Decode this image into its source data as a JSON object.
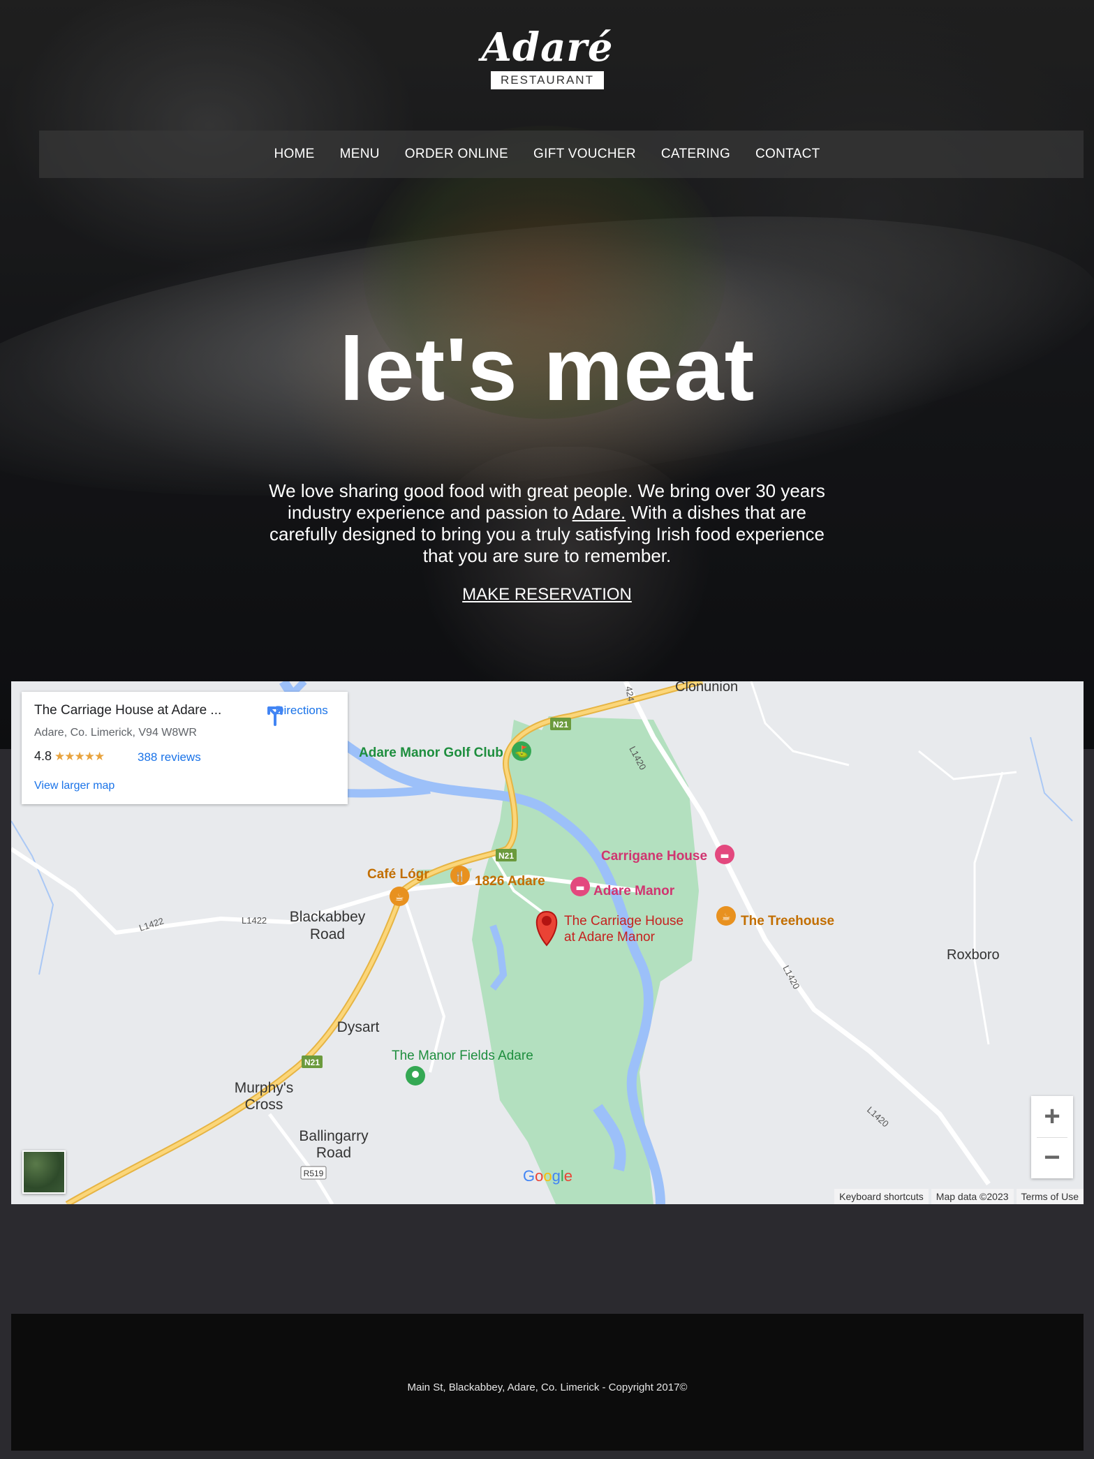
{
  "header": {
    "logo_script": "Adaré",
    "logo_sub": "RESTAURANT"
  },
  "nav": {
    "items": [
      "HOME",
      "MENU",
      "ORDER ONLINE",
      "GIFT VOUCHER",
      "CATERING",
      "CONTACT"
    ]
  },
  "hero": {
    "headline": "let's meat",
    "intro_before": "We love sharing good food with great people. We bring over 30 years industry experience and passion to ",
    "intro_link": "Adare.",
    "intro_after": " With a dishes that are carefully designed to bring you a truly satisfying Irish food experience that you are sure to remember.",
    "cta": "MAKE RESERVATION"
  },
  "map": {
    "card": {
      "title": "The Carriage House at Adare ...",
      "address": "Adare, Co. Limerick, V94 W8WR",
      "rating": "4.8",
      "stars": "★★★★★",
      "reviews": "388 reviews",
      "larger_map": "View larger map",
      "directions": "Directions"
    },
    "labels": {
      "clonunion": "Clonunion",
      "golf": "Adare Manor Golf Club",
      "carrigane": "Carrigane House",
      "cafe": "Café Lógr",
      "adare1826": "1826 Adare",
      "adare_manor": "Adare Manor",
      "carriage_1": "The Carriage House",
      "carriage_2": "at Adare Manor",
      "treehouse": "The Treehouse",
      "blackabbey_1": "Blackabbey",
      "blackabbey_2": "Road",
      "roxboro": "Roxboro",
      "dysart": "Dysart",
      "manor_fields": "The Manor Fields Adare",
      "murphys_1": "Murphy's",
      "murphys_2": "Cross",
      "ballingarry_1": "Ballingarry",
      "ballingarry_2": "Road",
      "n21": "N21",
      "r519": "R519",
      "l1422": "L1422",
      "l1420": "L1420",
      "r424": "424"
    },
    "zoom_in": "+",
    "zoom_out": "−",
    "google": "Google",
    "attribution": [
      "Keyboard shortcuts",
      "Map data ©2023",
      "Terms of Use"
    ],
    "colors": {
      "park": "#b3e0bf",
      "water": "#9cc0f9",
      "road_major": "#f6c94e",
      "pin": "#ea4335",
      "poi_food": "#e8911f",
      "poi_lodging": "#e3487e",
      "poi_green": "#34a853"
    }
  },
  "footer": {
    "text": "Main St, Blackabbey, Adare, Co. Limerick - Copyright 2017©"
  }
}
